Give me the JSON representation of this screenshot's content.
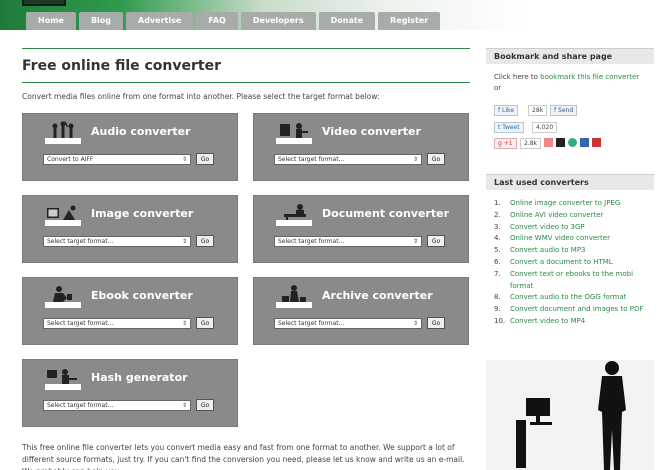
{
  "nav": [
    "Home",
    "Blog",
    "Advertise",
    "FAQ",
    "Developers",
    "Donate",
    "Register"
  ],
  "main": {
    "title": "Free online file converter",
    "intro": "Convert media files online from one format into another. Please select the target format below:",
    "converters": [
      {
        "title": "Audio converter",
        "select": "Convert to AIFF",
        "go": "Go",
        "icon": "audio-people-icon"
      },
      {
        "title": "Video converter",
        "select": "Select target format...",
        "go": "Go",
        "icon": "video-person-icon"
      },
      {
        "title": "Image converter",
        "select": "Select target format...",
        "go": "Go",
        "icon": "image-photo-icon"
      },
      {
        "title": "Document converter",
        "select": "Select target format...",
        "go": "Go",
        "icon": "document-person-icon"
      },
      {
        "title": "Ebook converter",
        "select": "Select target format...",
        "go": "Go",
        "icon": "ebook-reader-icon"
      },
      {
        "title": "Archive converter",
        "select": "Select target format...",
        "go": "Go",
        "icon": "archive-person-icon"
      },
      {
        "title": "Hash generator",
        "select": "Select target format...",
        "go": "Go",
        "icon": "hash-person-icon"
      }
    ],
    "bottom_text": "This free online file converter lets you convert media easy and fast from one format to another. We support a lot of different source formats, just try. If you can't find the conversion you need, please let us know and write us an e-mail. We probably can help you."
  },
  "sidebar": {
    "bookmark_head": "Bookmark and share page",
    "bookmark_pre": "Click here to ",
    "bookmark_link": "bookmark this file converter",
    "bookmark_post": " or",
    "like": "Like",
    "like_count": "28k",
    "send": "Send",
    "tweet": "Tweet",
    "tweet_count": "4,020",
    "plus": "+1",
    "plus_count": "2.8k",
    "last_head": "Last used converters",
    "last": [
      "Online image converter to JPEG",
      "Online AVI video converter",
      "Convert video to 3GP",
      "Online WMV video converter",
      "Convert audio to MP3",
      "Convert a document to HTML",
      "Convert text or ebooks to the mobi format",
      "Convert audio to the OGG format",
      "Convert document and images to PDF",
      "Convert video to MP4"
    ]
  },
  "colors": {
    "accent": "#2a8a45",
    "box": "#8a8a8a",
    "nav_tab": "#a8aca8"
  }
}
